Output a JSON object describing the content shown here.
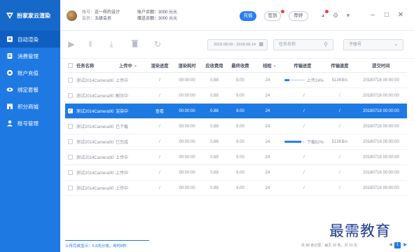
{
  "app": {
    "name": "扮家家云渲染"
  },
  "sidebar": {
    "items": [
      {
        "label": "自动渲染",
        "icon": "layers-icon",
        "active": true
      },
      {
        "label": "消费管理",
        "icon": "receipt-icon",
        "active": false
      },
      {
        "label": "账户充值",
        "icon": "coin-icon",
        "active": false
      },
      {
        "label": "绑定套餐",
        "icon": "eye-icon",
        "active": false
      },
      {
        "label": "积分商城",
        "icon": "store-icon",
        "active": false
      },
      {
        "label": "账号管理",
        "icon": "user-icon",
        "active": false
      }
    ]
  },
  "header": {
    "account_key": "账号：",
    "account_value": "这一样的设计",
    "member_key": "会员：",
    "member_value": "五级会员",
    "balance_label": "账户余额：",
    "balance_value": "3000 元元",
    "gift_label": "赠送余额：",
    "gift_value": "3000 元元",
    "recharge_label": "充值",
    "sign_label": "签到",
    "friend_label": "荐好"
  },
  "toolbar": {
    "date_range": "2018.08.09 - 2018.08.14",
    "search_placeholder": "任务名称",
    "sub_account_placeholder": "子账号"
  },
  "table": {
    "headers": [
      "任务名称",
      "上传中",
      "渲染进度",
      "渲染耗时",
      "应收费用",
      "最终收费",
      "线程",
      "传输进度",
      "传输速度",
      "提交时间"
    ],
    "rows": [
      {
        "name": "测试2014Camera001",
        "status": "上传中",
        "render_progress": "/",
        "render_time": "00:00:00",
        "fee": "0.88",
        "final_fee": "9.00",
        "threads": "24",
        "transfer": "上传24%",
        "transfer_pct": 24,
        "speed": "512KB/s",
        "time": "20180718 00:00:00",
        "selected": false
      },
      {
        "name": "测试2014Camera001",
        "status": "解压中",
        "render_progress": "/",
        "render_time": "00:00:00",
        "fee": "0.88",
        "final_fee": "9.00",
        "threads": "24",
        "transfer": "/",
        "transfer_pct": null,
        "speed": "/",
        "time": "20180718 00:00:00",
        "selected": false
      },
      {
        "name": "测试2014Camera001",
        "status": "渲染中",
        "render_progress": "查看",
        "render_time": "00:00:00",
        "fee": "0.88",
        "final_fee": "9.00",
        "threads": "24",
        "transfer": "/",
        "transfer_pct": null,
        "speed": "/",
        "time": "20180718 00:00:00",
        "selected": true
      },
      {
        "name": "测试2014Camera001",
        "status": "已下载",
        "render_progress": "/",
        "render_time": "00:00:00",
        "fee": "0.88",
        "final_fee": "9.00",
        "threads": "24",
        "transfer": "/",
        "transfer_pct": null,
        "speed": "/",
        "time": "20180718 00:00:00",
        "selected": false
      },
      {
        "name": "测试2014Camera001...",
        "status": "已完成",
        "render_progress": "/",
        "render_time": "00:00:00",
        "fee": "0.88",
        "final_fee": "9.00",
        "threads": "24",
        "transfer": "下载82%",
        "transfer_pct": 82,
        "speed": "512KB/s",
        "time": "20180718 00:00:00",
        "selected": false
      },
      {
        "name": "测试2014Camera001",
        "status": "上传中",
        "render_progress": "/",
        "render_time": "00:00:00",
        "fee": "0.88",
        "final_fee": "9.00",
        "threads": "24",
        "transfer": "/",
        "transfer_pct": null,
        "speed": "/",
        "time": "20180718 00:00:00",
        "selected": false
      },
      {
        "name": "测试2014Camera001",
        "status": "上传中",
        "render_progress": "/",
        "render_time": "00:00:00",
        "fee": "0.88",
        "final_fee": "9.00",
        "threads": "24",
        "transfer": "/",
        "transfer_pct": null,
        "speed": "/",
        "time": "20180718 00:00:00",
        "selected": false
      },
      {
        "name": "测试2014Camera001",
        "status": "上传中",
        "render_progress": "/",
        "render_time": "00:00:00",
        "fee": "0.88",
        "final_fee": "9.00",
        "threads": "24",
        "transfer": "/",
        "transfer_pct": null,
        "speed": "/",
        "time": "20180718 00:00:00",
        "selected": false
      }
    ]
  },
  "status": {
    "left": "上传完成显示：5.8兆分成，用时8秒",
    "right": "共 88 条记录，每页 20 条，共 10 页",
    "page": "1"
  },
  "watermark": "最需教育",
  "colors": {
    "accent": "#1e79e3",
    "sidebar": "#1e79e3",
    "selected_row": "#1e79e3"
  }
}
